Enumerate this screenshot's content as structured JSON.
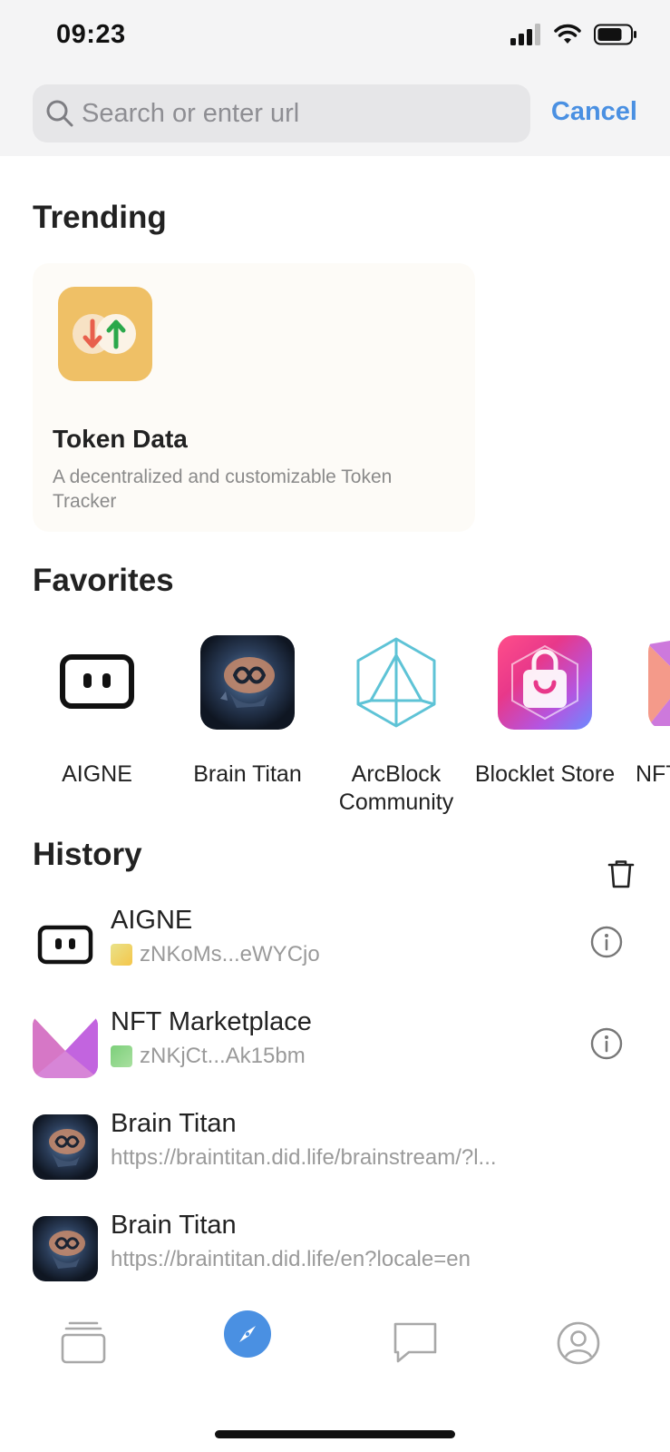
{
  "status_bar": {
    "time": "09:23"
  },
  "search": {
    "placeholder": "Search or enter url",
    "cancel_label": "Cancel"
  },
  "trending": {
    "title": "Trending",
    "card": {
      "name": "Token Data",
      "description": "A decentralized and customizable Token Tracker"
    }
  },
  "favorites": {
    "title": "Favorites",
    "items": [
      {
        "label": "AIGNE"
      },
      {
        "label": "Brain Titan"
      },
      {
        "label": "ArcBlock Community"
      },
      {
        "label": "Blocklet Store"
      },
      {
        "label": "NFT"
      }
    ]
  },
  "history": {
    "title": "History",
    "items": [
      {
        "title": "AIGNE",
        "subtitle": "zNKoMs...eWYCjo"
      },
      {
        "title": "NFT Marketplace",
        "subtitle": "zNKjCt...Ak15bm"
      },
      {
        "title": "Brain Titan",
        "subtitle": "https://braintitan.did.life/brainstream/?l..."
      },
      {
        "title": "Brain Titan",
        "subtitle": "https://braintitan.did.life/en?locale=en"
      }
    ]
  },
  "colors": {
    "accent": "#4a90e2",
    "token_icon_bg": "#efc066"
  }
}
